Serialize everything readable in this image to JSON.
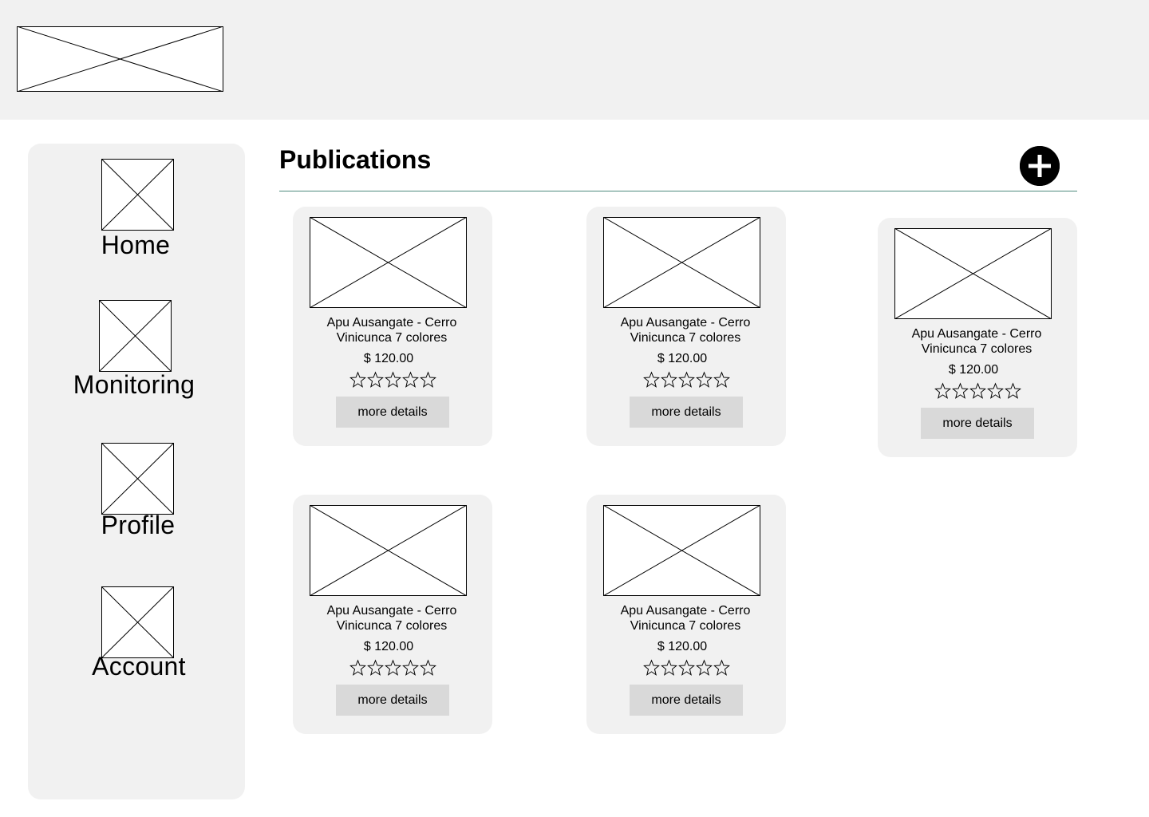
{
  "header": {
    "logo_icon": "image-placeholder-icon"
  },
  "sidebar": {
    "items": [
      {
        "label": "Home",
        "icon": "image-placeholder-icon"
      },
      {
        "label": "Monitoring",
        "icon": "image-placeholder-icon"
      },
      {
        "label": "Profile",
        "icon": "image-placeholder-icon"
      },
      {
        "label": "Account",
        "icon": "image-placeholder-icon"
      }
    ]
  },
  "main": {
    "title": "Publications",
    "add_icon": "plus-circle-icon",
    "cards": [
      {
        "title_line1": "Apu Ausangate - Cerro",
        "title_line2": "Vinicunca 7 colores",
        "price": "$ 120.00",
        "rating": 0,
        "max_rating": 5,
        "button_label": "more details"
      },
      {
        "title_line1": "Apu Ausangate - Cerro",
        "title_line2": "Vinicunca 7 colores",
        "price": "$ 120.00",
        "rating": 0,
        "max_rating": 5,
        "button_label": "more details"
      },
      {
        "title_line1": "Apu Ausangate - Cerro",
        "title_line2": "Vinicunca 7 colores",
        "price": "$ 120.00",
        "rating": 0,
        "max_rating": 5,
        "button_label": "more details"
      },
      {
        "title_line1": "Apu Ausangate - Cerro",
        "title_line2": "Vinicunca 7 colores",
        "price": "$ 120.00",
        "rating": 0,
        "max_rating": 5,
        "button_label": "more details"
      },
      {
        "title_line1": "Apu Ausangate - Cerro",
        "title_line2": "Vinicunca 7 colores",
        "price": "$ 120.00",
        "rating": 0,
        "max_rating": 5,
        "button_label": "more details"
      }
    ]
  }
}
